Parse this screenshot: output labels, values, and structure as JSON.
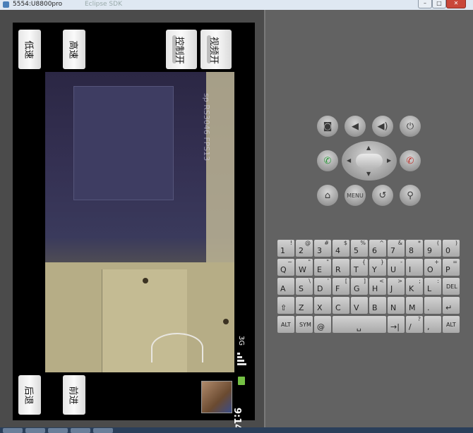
{
  "window": {
    "title": "5554:U8800pro",
    "ghost_title": "Eclipse SDK",
    "buttons": [
      "–",
      "□",
      "✕"
    ]
  },
  "app": {
    "buttons": {
      "low_speed": "低速",
      "high_speed": "高速",
      "control_toggle": "控制开",
      "video_toggle": "视频开",
      "backward": "后退",
      "forward": "前进"
    },
    "video_overlay": "sp RS3046 FPS13"
  },
  "device_status": {
    "network": "3G",
    "time": "9:14"
  },
  "hardware_controls": {
    "menu_label": "MENU"
  },
  "keyboard": {
    "row1": [
      {
        "main": "1",
        "sub": "!"
      },
      {
        "main": "2",
        "sub": "@"
      },
      {
        "main": "3",
        "sub": "#"
      },
      {
        "main": "4",
        "sub": "$"
      },
      {
        "main": "5",
        "sub": "%"
      },
      {
        "main": "6",
        "sub": "^"
      },
      {
        "main": "7",
        "sub": "&"
      },
      {
        "main": "8",
        "sub": "*"
      },
      {
        "main": "9",
        "sub": "("
      },
      {
        "main": "0",
        "sub": ")"
      }
    ],
    "row2": [
      {
        "main": "Q",
        "sub": "~"
      },
      {
        "main": "W",
        "sub": "\""
      },
      {
        "main": "E",
        "sub": "\""
      },
      {
        "main": "R",
        "sub": ""
      },
      {
        "main": "T",
        "sub": "{"
      },
      {
        "main": "Y",
        "sub": "}"
      },
      {
        "main": "U",
        "sub": "-"
      },
      {
        "main": "I",
        "sub": ""
      },
      {
        "main": "O",
        "sub": "+"
      },
      {
        "main": "P",
        "sub": "="
      }
    ],
    "row3": [
      {
        "main": "A",
        "sub": ""
      },
      {
        "main": "S",
        "sub": "\\"
      },
      {
        "main": "D",
        "sub": "'"
      },
      {
        "main": "F",
        "sub": "["
      },
      {
        "main": "G",
        "sub": "]"
      },
      {
        "main": "H",
        "sub": "<"
      },
      {
        "main": "J",
        "sub": ">"
      },
      {
        "main": "K",
        "sub": ";"
      },
      {
        "main": "L",
        "sub": ":"
      },
      {
        "main": "DEL",
        "sub": ""
      }
    ],
    "row4": [
      {
        "main": "⇧",
        "sub": ""
      },
      {
        "main": "Z",
        "sub": ""
      },
      {
        "main": "X",
        "sub": ""
      },
      {
        "main": "C",
        "sub": ""
      },
      {
        "main": "V",
        "sub": ""
      },
      {
        "main": "B",
        "sub": ""
      },
      {
        "main": "N",
        "sub": ""
      },
      {
        "main": "M",
        "sub": ""
      },
      {
        "main": ".",
        "sub": ""
      },
      {
        "main": "↵",
        "sub": ""
      }
    ],
    "row5": [
      {
        "main": "ALT"
      },
      {
        "main": "SYM"
      },
      {
        "main": "@"
      },
      {
        "main": "␣"
      },
      {
        "main": "→|"
      },
      {
        "main": "/",
        "sub": "?"
      },
      {
        "main": ",",
        "sub": ""
      },
      {
        "main": "ALT"
      }
    ]
  }
}
